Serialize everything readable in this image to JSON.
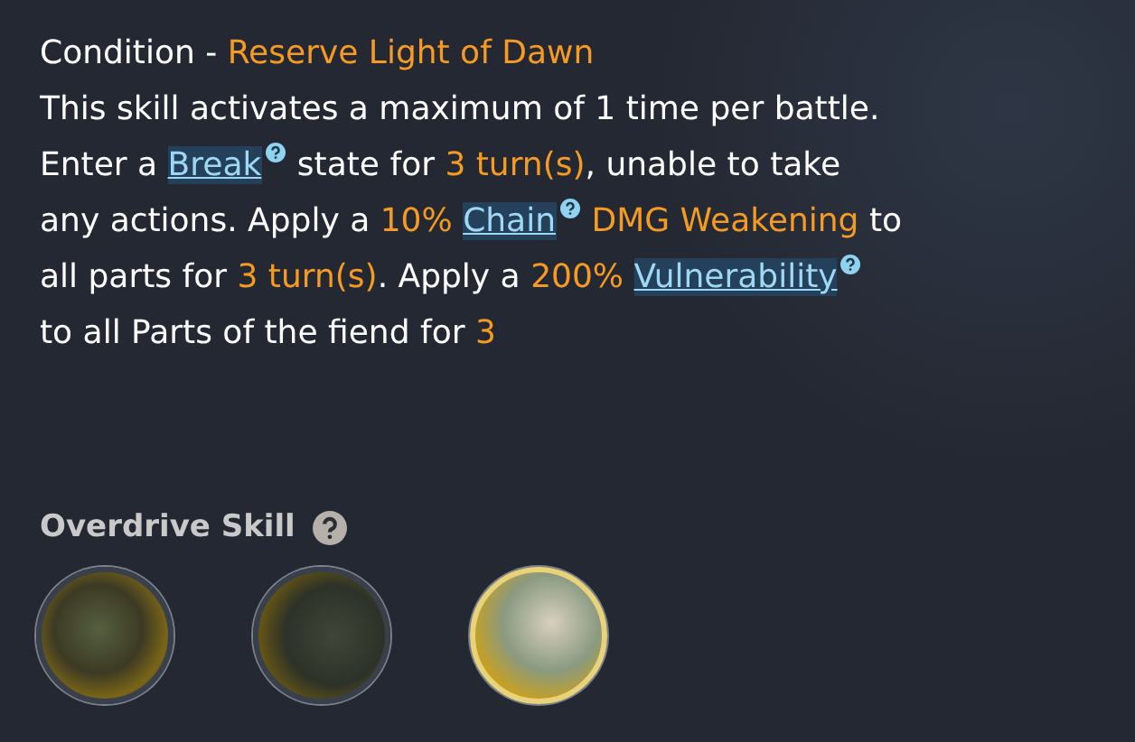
{
  "condition": {
    "label": "Condition - ",
    "name": "Reserve Light of Dawn"
  },
  "paragraphs": [
    [
      {
        "kind": "plain",
        "text": "This skill activates a maximum of 1 time per battle."
      }
    ],
    [
      {
        "kind": "plain",
        "text": "Enter a "
      },
      {
        "kind": "link",
        "text": "Break"
      },
      {
        "kind": "plain",
        "text": " state for "
      },
      {
        "kind": "highlight",
        "text": "3 turn(s)"
      },
      {
        "kind": "plain",
        "text": ", unable to take any actions. Apply a "
      },
      {
        "kind": "highlight",
        "text": "10% "
      },
      {
        "kind": "link",
        "text": "Chain"
      },
      {
        "kind": "highlight",
        "text": " DMG Weakening"
      },
      {
        "kind": "plain",
        "text": " to all parts for "
      },
      {
        "kind": "highlight",
        "text": "3 turn(s)"
      },
      {
        "kind": "plain",
        "text": ". Apply a "
      },
      {
        "kind": "highlight",
        "text": "200% "
      },
      {
        "kind": "link",
        "text": "Vulnerability"
      },
      {
        "kind": "plain",
        "text": " to all Parts of the fiend for "
      },
      {
        "kind": "highlight",
        "text": "3"
      }
    ]
  ],
  "overdrive": {
    "title": "Overdrive Skill",
    "skills": [
      {
        "selected": false
      },
      {
        "selected": false
      },
      {
        "selected": true
      }
    ]
  }
}
